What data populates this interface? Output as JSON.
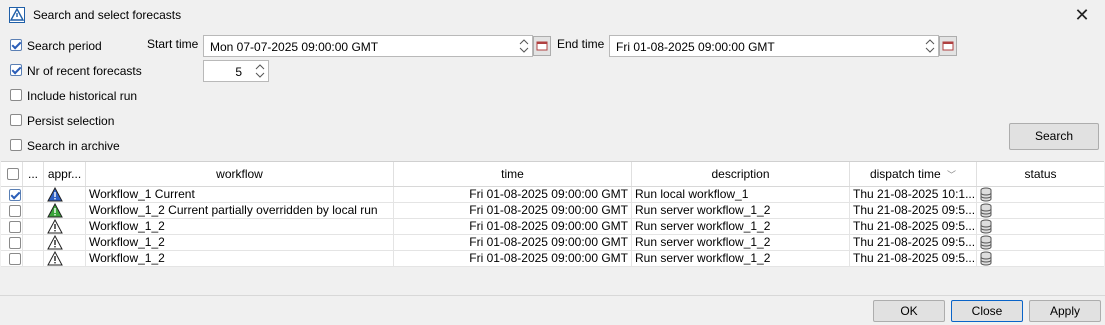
{
  "window": {
    "title": "Search and select forecasts",
    "close_icon": "close-icon"
  },
  "options": {
    "search_period": {
      "label": "Search period",
      "checked": true
    },
    "nr_recent": {
      "label": "Nr of recent forecasts",
      "checked": true,
      "value": "5"
    },
    "include_historical": {
      "label": "Include historical run",
      "checked": false
    },
    "persist_selection": {
      "label": "Persist selection",
      "checked": false
    },
    "search_archive": {
      "label": "Search in archive",
      "checked": false
    }
  },
  "start_time": {
    "label": "Start time",
    "value": "Mon 07-07-2025 09:00:00 GMT"
  },
  "end_time": {
    "label": "End time",
    "value": "Fri 01-08-2025 09:00:00 GMT"
  },
  "search_button": "Search",
  "table": {
    "columns": [
      "...",
      "appr...",
      "workflow",
      "time",
      "description",
      "dispatch time",
      "status"
    ],
    "rows": [
      {
        "checked": true,
        "icon": "blue-warning-icon",
        "workflow": "Workflow_1 Current",
        "time": "Fri 01-08-2025 09:00:00 GMT",
        "description": "Run local workflow_1",
        "dispatch": "Thu 21-08-2025 10:1...",
        "status": "database-icon"
      },
      {
        "checked": false,
        "icon": "green-warning-icon",
        "workflow": "Workflow_1_2 Current partially overridden by local run",
        "time": "Fri 01-08-2025 09:00:00 GMT",
        "description": "Run server workflow_1_2",
        "dispatch": "Thu 21-08-2025 09:5...",
        "status": "database-icon"
      },
      {
        "checked": false,
        "icon": "white-warning-icon",
        "workflow": "Workflow_1_2",
        "time": "Fri 01-08-2025 09:00:00 GMT",
        "description": "Run server workflow_1_2",
        "dispatch": "Thu 21-08-2025 09:5...",
        "status": "database-icon"
      },
      {
        "checked": false,
        "icon": "white-warning-icon",
        "workflow": "Workflow_1_2",
        "time": "Fri 01-08-2025 09:00:00 GMT",
        "description": "Run server workflow_1_2",
        "dispatch": "Thu 21-08-2025 09:5...",
        "status": "database-icon"
      },
      {
        "checked": false,
        "icon": "white-warning-icon",
        "workflow": "Workflow_1_2",
        "time": "Fri 01-08-2025 09:00:00 GMT",
        "description": "Run server workflow_1_2",
        "dispatch": "Thu 21-08-2025 09:5...",
        "status": "database-icon"
      }
    ]
  },
  "footer": {
    "ok": "OK",
    "close": "Close",
    "apply": "Apply"
  }
}
